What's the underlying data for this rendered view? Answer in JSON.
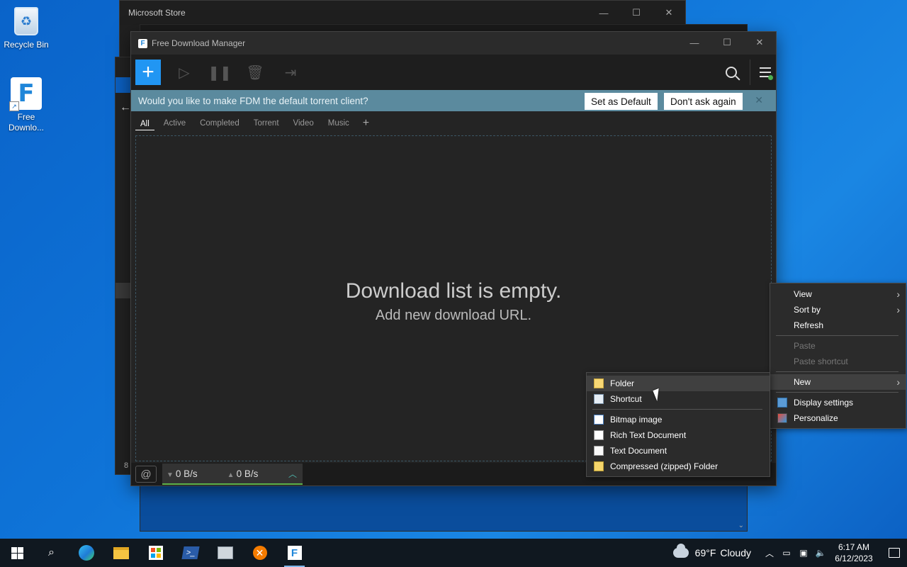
{
  "desktop": {
    "icons": [
      {
        "label": "Recycle Bin",
        "icon": "recycle-bin-icon"
      },
      {
        "label": "Free\nDownlo...",
        "icon": "fdm-shortcut-icon"
      }
    ]
  },
  "store_window": {
    "title": "Microsoft Store"
  },
  "back_window": {
    "number_fragment": "8"
  },
  "fdm": {
    "title": "Free Download Manager",
    "toolbar": {
      "add_label": "+",
      "icons": [
        "add-icon",
        "resume-icon",
        "pause-icon",
        "delete-icon",
        "move-icon",
        "search-icon",
        "menu-icon"
      ]
    },
    "banner": {
      "message": "Would you like to make FDM the default torrent client?",
      "set_default": "Set as Default",
      "dont_ask": "Don't ask again",
      "close": "✕"
    },
    "tabs": [
      "All",
      "Active",
      "Completed",
      "Torrent",
      "Video",
      "Music"
    ],
    "add_tab": "+",
    "empty": {
      "title": "Download list is empty.",
      "subtitle": "Add new download URL."
    },
    "status": {
      "down_speed": "0 B/s",
      "up_speed": "0 B/s"
    }
  },
  "context_menu": {
    "items": [
      {
        "label": "View",
        "submenu": true
      },
      {
        "label": "Sort by",
        "submenu": true
      },
      {
        "label": "Refresh"
      },
      {
        "label": "Paste",
        "disabled": true
      },
      {
        "label": "Paste shortcut",
        "disabled": true
      },
      {
        "label": "New",
        "submenu": true,
        "highlighted": true
      },
      {
        "label": "Display settings",
        "icon": "display-settings-icon"
      },
      {
        "label": "Personalize",
        "icon": "personalize-icon"
      }
    ]
  },
  "new_submenu": {
    "items": [
      {
        "label": "Folder",
        "icon": "folder-icon",
        "highlighted": true
      },
      {
        "label": "Shortcut",
        "icon": "shortcut-icon"
      },
      {
        "label": "Bitmap image",
        "icon": "bitmap-icon"
      },
      {
        "label": "Rich Text Document",
        "icon": "rtf-document-icon"
      },
      {
        "label": "Text Document",
        "icon": "text-document-icon"
      },
      {
        "label": "Compressed (zipped) Folder",
        "icon": "zip-folder-icon"
      }
    ]
  },
  "taskbar": {
    "apps": [
      "start-icon",
      "search-icon",
      "edge-icon",
      "file-explorer-icon",
      "store-icon",
      "powershell-icon",
      "app-icon",
      "xampp-icon",
      "fdm-icon"
    ],
    "weather": {
      "temp": "69°F",
      "condition": "Cloudy"
    },
    "clock": {
      "time": "6:17 AM",
      "date": "6/12/2023"
    }
  },
  "colors": {
    "accent": "#2196f3",
    "banner": "#5b8a9e",
    "speed_bar": "#5fb34a"
  }
}
